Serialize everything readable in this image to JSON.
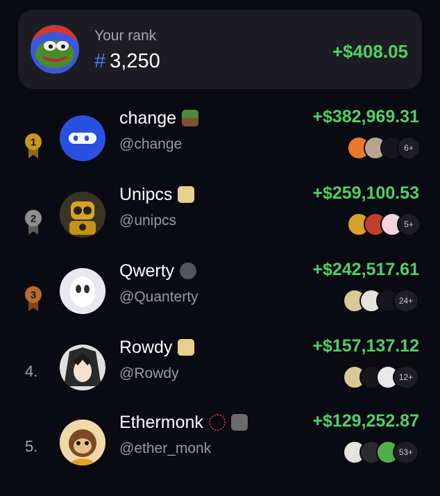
{
  "your_rank": {
    "label": "Your rank",
    "hash": "#",
    "rank": "3,250",
    "pnl": "+$408.05"
  },
  "leaders": [
    {
      "position": "1",
      "name": "change",
      "handle": "@change",
      "pnl": "+$382,969.31",
      "more": "6+"
    },
    {
      "position": "2",
      "name": "Unipcs",
      "handle": "@unipcs",
      "pnl": "+$259,100.53",
      "more": "5+"
    },
    {
      "position": "3",
      "name": "Qwerty",
      "handle": "@Quanterty",
      "pnl": "+$242,517.61",
      "more": "24+"
    },
    {
      "position": "4.",
      "name": "Rowdy",
      "handle": "@Rowdy",
      "pnl": "+$157,137.12",
      "more": "12+"
    },
    {
      "position": "5.",
      "name": "Ethermonk",
      "handle": "@ether_monk",
      "pnl": "+$129,252.87",
      "more": "53+"
    }
  ],
  "colors": {
    "background": "#0a0a12",
    "card": "#1c1c22",
    "positive": "#4fd164",
    "rank_hash": "#4e76ff",
    "gold": "#c9961e",
    "silver": "#8d8d8d",
    "bronze": "#b86b2b"
  },
  "icons": [
    "pepe-avatar-icon",
    "gold-medal-icon",
    "silver-medal-icon",
    "bronze-medal-icon",
    "verified-badge-icon",
    "token-icon"
  ]
}
